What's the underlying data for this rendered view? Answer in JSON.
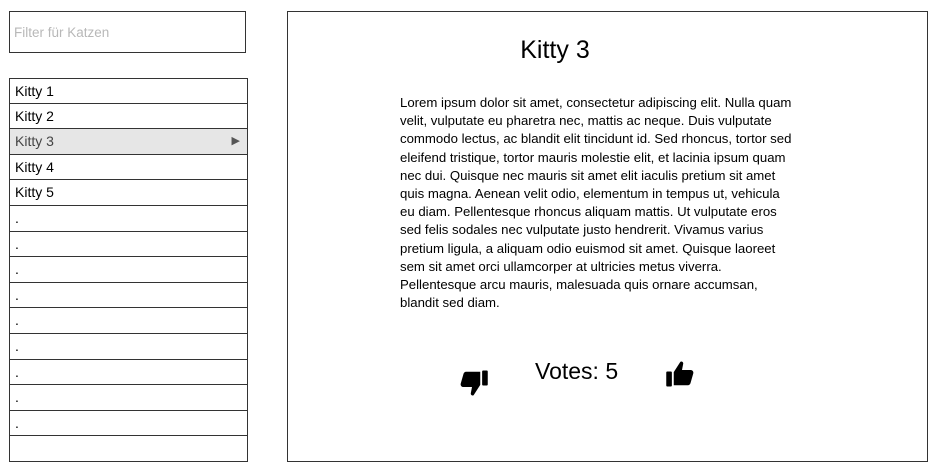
{
  "filter": {
    "placeholder": "Filter für Katzen",
    "value": ""
  },
  "list": {
    "items": [
      {
        "label": "Kitty 1"
      },
      {
        "label": "Kitty 2"
      },
      {
        "label": "Kitty 3",
        "selected": true
      },
      {
        "label": "Kitty 4"
      },
      {
        "label": "Kitty 5"
      },
      {
        "label": "."
      },
      {
        "label": "."
      },
      {
        "label": "."
      },
      {
        "label": "."
      },
      {
        "label": "."
      },
      {
        "label": "."
      },
      {
        "label": "."
      },
      {
        "label": "."
      },
      {
        "label": "."
      },
      {
        "label": ""
      }
    ],
    "selected_marker_icon": "triangle-right-icon"
  },
  "detail": {
    "title": "Kitty 3",
    "description": "Lorem ipsum dolor sit amet, consectetur adipiscing elit. Nulla quam velit, vulputate eu pharetra nec, mattis ac neque. Duis vulputate commodo lectus, ac blandit elit tincidunt id. Sed rhoncus, tortor sed eleifend tristique, tortor mauris molestie elit, et lacinia ipsum quam nec dui. Quisque nec mauris sit amet elit iaculis pretium sit amet quis magna. Aenean velit odio, elementum in tempus ut, vehicula eu diam. Pellentesque rhoncus aliquam mattis. Ut vulputate eros sed felis sodales nec vulputate justo hendrerit. Vivamus varius pretium ligula, a aliquam odio euismod sit amet. Quisque laoreet sem sit amet orci ullamcorper at ultricies metus viverra. Pellentesque arcu mauris, malesuada quis ornare accumsan, blandit sed diam.",
    "votes_label": "Votes: 5",
    "downvote_icon": "thumbs-down-icon",
    "upvote_icon": "thumbs-up-icon"
  }
}
